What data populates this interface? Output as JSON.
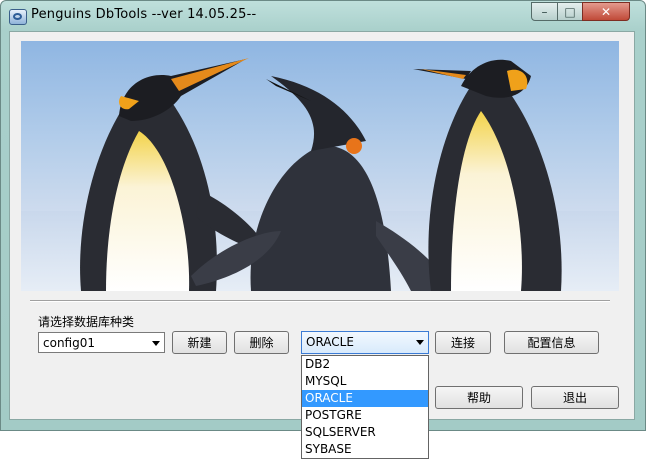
{
  "window": {
    "title": "Penguins DbTools --ver 14.05.25--",
    "controls": {
      "minimize": "–",
      "maximize": "□",
      "close": "✕"
    }
  },
  "form": {
    "prompt": "请选择数据库种类",
    "config_combo": {
      "value": "config01"
    },
    "new_button": "新建",
    "delete_button": "删除",
    "db_combo": {
      "value": "ORACLE",
      "options": [
        "DB2",
        "MYSQL",
        "ORACLE",
        "POSTGRE",
        "SQLSERVER",
        "SYBASE"
      ],
      "selected_index": 2
    },
    "connect_button": "连接",
    "config_info_button": "配置信息",
    "help_button": "帮助",
    "exit_button": "退出"
  },
  "colors": {
    "selection": "#3399ff",
    "title_bar": "#a9d0cb"
  },
  "icons": {
    "app": "app-logo-icon",
    "dropdown": "chevron-down-icon"
  }
}
